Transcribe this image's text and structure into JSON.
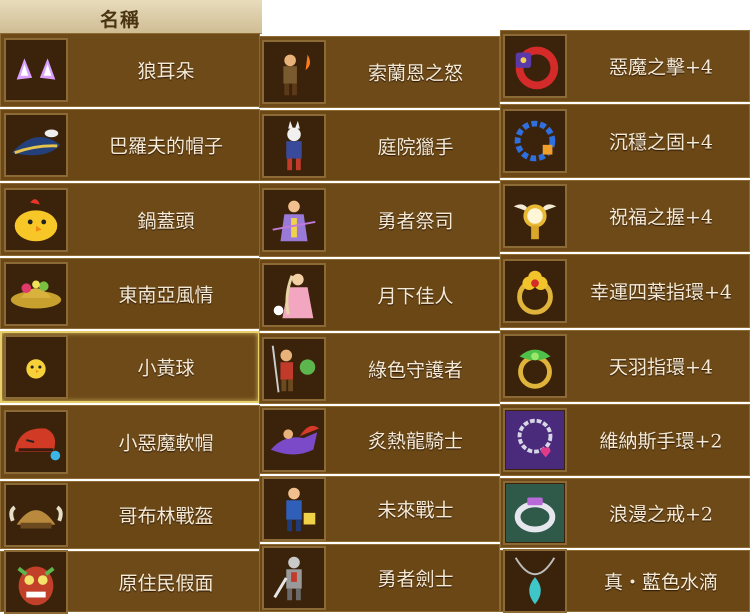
{
  "header": {
    "title": "名稱"
  },
  "columns": [
    {
      "items": [
        {
          "name": "狼耳朵",
          "icon": "wolf-ears-icon"
        },
        {
          "name": "巴羅夫的帽子",
          "icon": "pirate-hat-icon"
        },
        {
          "name": "鍋蓋頭",
          "icon": "yellow-chick-helmet-icon"
        },
        {
          "name": "東南亞風情",
          "icon": "flower-hat-icon"
        },
        {
          "name": "小黃球",
          "icon": "yellow-ball-icon"
        },
        {
          "name": "小惡魔軟帽",
          "icon": "devil-cap-icon"
        },
        {
          "name": "哥布林戰盔",
          "icon": "goblin-helmet-icon"
        },
        {
          "name": "原住民假面",
          "icon": "tribal-mask-icon"
        }
      ]
    },
    {
      "items": [
        {
          "name": "索蘭恩之怒",
          "icon": "warrior-character-icon"
        },
        {
          "name": "庭院獵手",
          "icon": "fox-character-icon"
        },
        {
          "name": "勇者祭司",
          "icon": "priest-character-icon"
        },
        {
          "name": "月下佳人",
          "icon": "lady-character-icon"
        },
        {
          "name": "綠色守護者",
          "icon": "guardian-character-icon"
        },
        {
          "name": "炙熱龍騎士",
          "icon": "dragon-rider-icon"
        },
        {
          "name": "未來戰士",
          "icon": "future-warrior-icon"
        },
        {
          "name": "勇者劍士",
          "icon": "swordsman-character-icon"
        }
      ]
    },
    {
      "items": [
        {
          "name": "惡魔之擊+4",
          "icon": "demon-bracelet-icon"
        },
        {
          "name": "沉穩之固+4",
          "icon": "blue-chain-icon"
        },
        {
          "name": "祝福之握+4",
          "icon": "winged-watch-icon"
        },
        {
          "name": "幸運四葉指環+4",
          "icon": "clover-ring-icon"
        },
        {
          "name": "天羽指環+4",
          "icon": "feather-ring-icon"
        },
        {
          "name": "維納斯手環+2",
          "icon": "heart-bracelet-icon"
        },
        {
          "name": "浪漫之戒+2",
          "icon": "silver-ring-icon"
        },
        {
          "name": "真・藍色水滴",
          "icon": "blue-drop-necklace-icon"
        }
      ]
    }
  ],
  "colors": {
    "row_bg": "#6d4a18",
    "border": "#8d6a34",
    "text": "#f4ead6",
    "highlight": "#e8cf6a"
  }
}
